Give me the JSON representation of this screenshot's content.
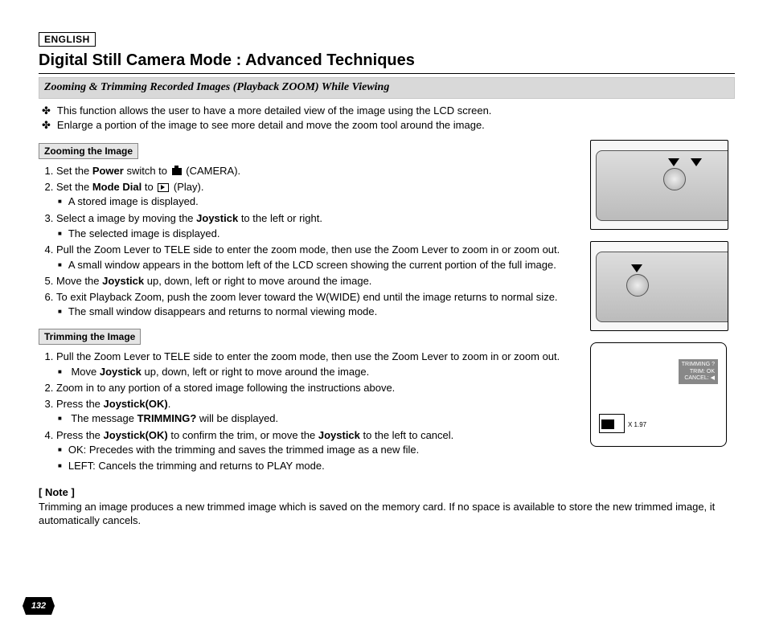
{
  "language_tag": "ENGLISH",
  "page_title": "Digital Still Camera Mode : Advanced Techniques",
  "section_heading": "Zooming & Trimming Recorded Images (Playback ZOOM) While Viewing",
  "intro_bullets": [
    "This function allows the user to have a more detailed view of the image using the LCD screen.",
    "Enlarge a portion of the image to see more detail and move the zoom tool around the image."
  ],
  "zooming": {
    "heading": "Zooming the Image",
    "step1_pre": "Set the ",
    "step1_bold": "Power",
    "step1_post": " switch to ",
    "step1_end": "(CAMERA).",
    "step2_pre": "Set the ",
    "step2_bold": "Mode Dial",
    "step2_mid": " to ",
    "step2_end": "(Play).",
    "step2_sub": "A stored image is displayed.",
    "step3_pre": "Select a image by moving the ",
    "step3_bold": "Joystick",
    "step3_post": " to the left or right.",
    "step3_sub": "The selected image is displayed.",
    "step4": "Pull the Zoom Lever to TELE side to enter the zoom mode, then use the Zoom Lever to zoom in or zoom out.",
    "step4_sub": "A small window appears in the bottom left of the LCD screen showing the current portion of the full image.",
    "step5_pre": "Move the ",
    "step5_bold": "Joystick",
    "step5_post": " up, down, left or right to move around the image.",
    "step6": "To exit Playback Zoom, push the zoom lever toward the W(WIDE) end until the image returns to normal size.",
    "step6_sub": "The small window disappears and returns to normal viewing mode."
  },
  "trimming": {
    "heading": "Trimming the Image",
    "step1": "Pull the Zoom Lever to TELE side to enter the zoom mode, then use the Zoom Lever to zoom in or zoom out.",
    "step1_sub_pre": "Move ",
    "step1_sub_bold": "Joystick",
    "step1_sub_post": " up, down, left or right  to move around the image.",
    "step2": "Zoom in to any portion of a stored image following the instructions above.",
    "step3_pre": "Press the ",
    "step3_bold": "Joystick(OK)",
    "step3_post": ".",
    "step3_sub_pre": "The message ",
    "step3_sub_bold": "TRIMMING?",
    "step3_sub_post": " will be displayed.",
    "step4_pre": "Press the ",
    "step4_bold1": "Joystick(OK)",
    "step4_mid": " to confirm the trim, or move the ",
    "step4_bold2": "Joystick",
    "step4_post": " to the left to cancel.",
    "step4_sub1": "OK: Precedes with the trimming and saves the trimmed image as a new file.",
    "step4_sub2": "LEFT: Cancels the trimming and returns to PLAY mode."
  },
  "note_label": "[ Note ]",
  "note_text": "Trimming an image produces a new trimmed image which is saved on the memory card. If no space is available to store the new trimmed image, it automatically cancels.",
  "lcd": {
    "line1": "TRIMMING ?",
    "line2": "TRIM: OK",
    "line3": "CANCEL: ◀",
    "zoom_value": "X 1.97"
  },
  "page_number": "132"
}
